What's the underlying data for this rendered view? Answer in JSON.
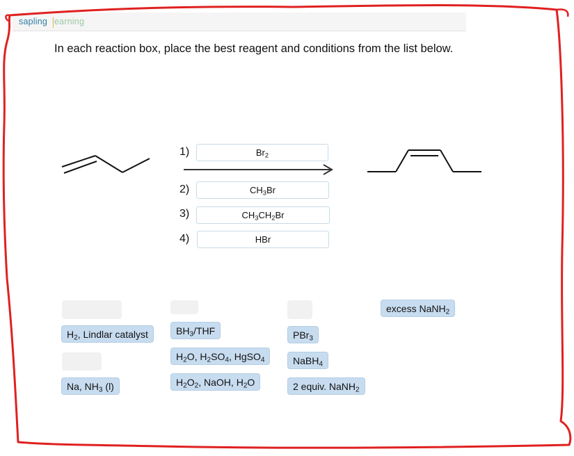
{
  "header": {
    "logo_part1": "sapling",
    "logo_part2": "learning"
  },
  "instructions": "In each reaction box, place the best reagent and conditions from the list below.",
  "reaction": {
    "steps": [
      {
        "number": "1)",
        "reagent": "Br<sub>2</sub>"
      },
      {
        "number": "2)",
        "reagent": "CH<sub>3</sub>Br"
      },
      {
        "number": "3)",
        "reagent": "CH<sub>3</sub>CH<sub>2</sub>Br"
      },
      {
        "number": "4)",
        "reagent": "HBr"
      }
    ]
  },
  "reagent_bank": [
    "H<sub>2</sub>, Lindlar catalyst",
    "Na, NH<sub>3</sub> (l)",
    "BH<sub>3</sub>/THF",
    "H<sub>2</sub>O, H<sub>2</sub>SO<sub>4</sub>, HgSO<sub>4</sub>",
    "H<sub>2</sub>O<sub>2</sub>, NaOH, H<sub>2</sub>O",
    "PBr<sub>3</sub>",
    "NaBH<sub>4</sub>",
    "2 equiv. NaNH<sub>2</sub>",
    "excess NaNH<sub>2</sub>"
  ],
  "colors": {
    "frame_annotation": "#e02020",
    "chip_fill": "#c8dcf0",
    "slot_border": "#c9dbe7"
  }
}
